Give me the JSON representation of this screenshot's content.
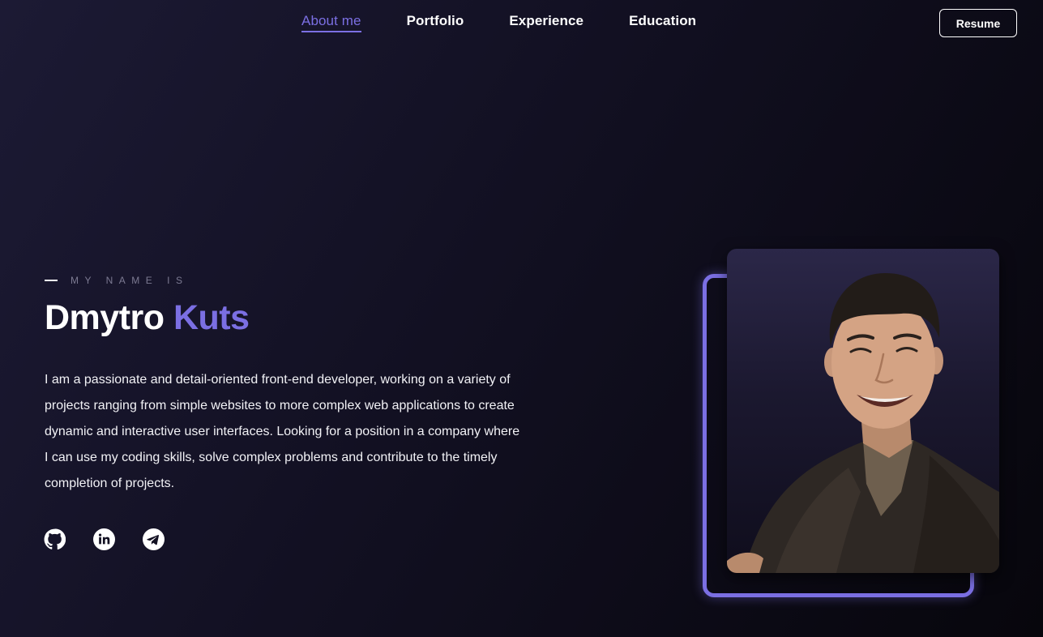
{
  "nav": {
    "links": [
      {
        "label": "About me",
        "active": true
      },
      {
        "label": "Portfolio",
        "active": false
      },
      {
        "label": "Experience",
        "active": false
      },
      {
        "label": "Education",
        "active": false
      }
    ],
    "resume_label": "Resume"
  },
  "hero": {
    "eyebrow": "MY NAME IS",
    "first_name": "Dmytro",
    "last_name": "Kuts",
    "bio": "I am a passionate and detail-oriented front-end developer, working on a variety of projects ranging from simple websites to more complex web applications to create dynamic and interactive user interfaces. Looking for a position in a company where I can use my coding skills, solve complex problems and contribute to the timely completion of projects."
  },
  "socials": [
    {
      "icon": "github-icon"
    },
    {
      "icon": "linkedin-icon"
    },
    {
      "icon": "telegram-icon"
    }
  ],
  "colors": {
    "accent": "#7b6fe3",
    "background": "#121022",
    "text": "#ffffff",
    "muted": "#7c7a92"
  }
}
